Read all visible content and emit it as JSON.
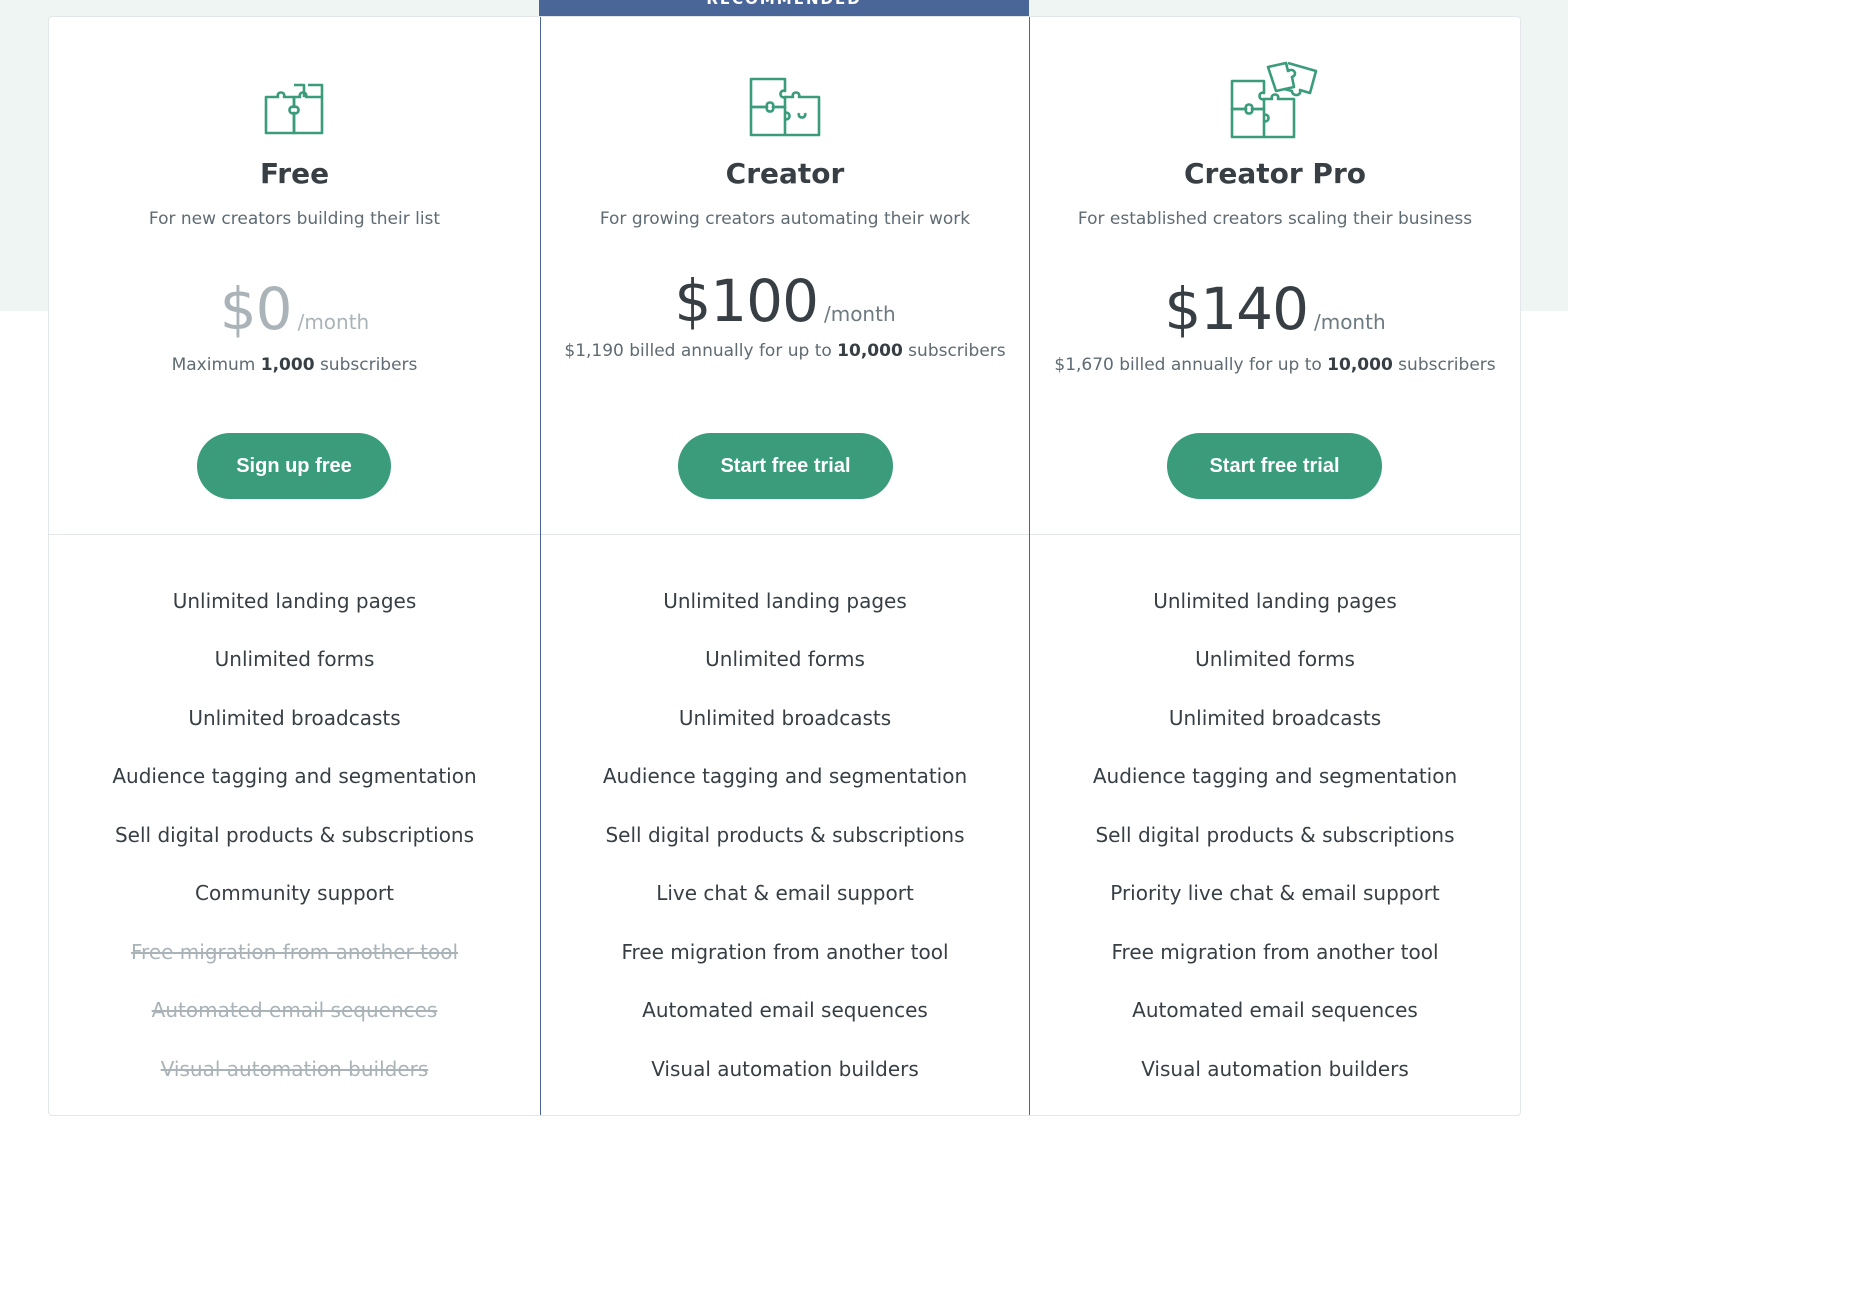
{
  "ribbon_label": "RECOMMENDED",
  "colors": {
    "accent_green": "#3a9c7a",
    "recommended_blue": "#4a6598",
    "background_band": "#eef5f2",
    "icon_stroke": "#3a9c7a"
  },
  "plans": [
    {
      "name": "Free",
      "description": "For new creators building their list",
      "price": "$0",
      "period": "/month",
      "billing_prefix": "Maximum ",
      "billing_bold": "1,000",
      "billing_suffix": " subscribers",
      "button_label": "Sign up free",
      "icon": "puzzle-icon",
      "features": [
        {
          "label": "Unlimited landing pages",
          "included": true
        },
        {
          "label": "Unlimited forms",
          "included": true
        },
        {
          "label": "Unlimited broadcasts",
          "included": true
        },
        {
          "label": "Audience tagging and segmentation",
          "included": true
        },
        {
          "label": "Sell digital products & subscriptions",
          "included": true
        },
        {
          "label": "Community support",
          "included": true
        },
        {
          "label": "Free migration from another tool",
          "included": false
        },
        {
          "label": "Automated email sequences",
          "included": false
        },
        {
          "label": "Visual automation builders",
          "included": false
        }
      ]
    },
    {
      "name": "Creator",
      "description": "For growing creators automating their work",
      "price": "$100",
      "period": "/month",
      "billing_prefix": "$1,190 billed annually for up to ",
      "billing_bold": "10,000",
      "billing_suffix": " subscribers",
      "button_label": "Start free trial",
      "icon": "puzzle-pieces-icon",
      "features": [
        {
          "label": "Unlimited landing pages",
          "included": true
        },
        {
          "label": "Unlimited forms",
          "included": true
        },
        {
          "label": "Unlimited broadcasts",
          "included": true
        },
        {
          "label": "Audience tagging and segmentation",
          "included": true
        },
        {
          "label": "Sell digital products & subscriptions",
          "included": true
        },
        {
          "label": "Live chat & email support",
          "included": true
        },
        {
          "label": "Free migration from another tool",
          "included": true
        },
        {
          "label": "Automated email sequences",
          "included": true
        },
        {
          "label": "Visual automation builders",
          "included": true
        }
      ]
    },
    {
      "name": "Creator Pro",
      "description": "For established creators scaling their business",
      "price": "$140",
      "period": "/month",
      "billing_prefix": "$1,670 billed annually for up to ",
      "billing_bold": "10,000",
      "billing_suffix": " subscribers",
      "button_label": "Start free trial",
      "icon": "puzzle-stack-icon",
      "features": [
        {
          "label": "Unlimited landing pages",
          "included": true
        },
        {
          "label": "Unlimited forms",
          "included": true
        },
        {
          "label": "Unlimited broadcasts",
          "included": true
        },
        {
          "label": "Audience tagging and segmentation",
          "included": true
        },
        {
          "label": "Sell digital products & subscriptions",
          "included": true
        },
        {
          "label": "Priority live chat & email support",
          "included": true
        },
        {
          "label": "Free migration from another tool",
          "included": true
        },
        {
          "label": "Automated email sequences",
          "included": true
        },
        {
          "label": "Visual automation builders",
          "included": true
        }
      ]
    }
  ]
}
